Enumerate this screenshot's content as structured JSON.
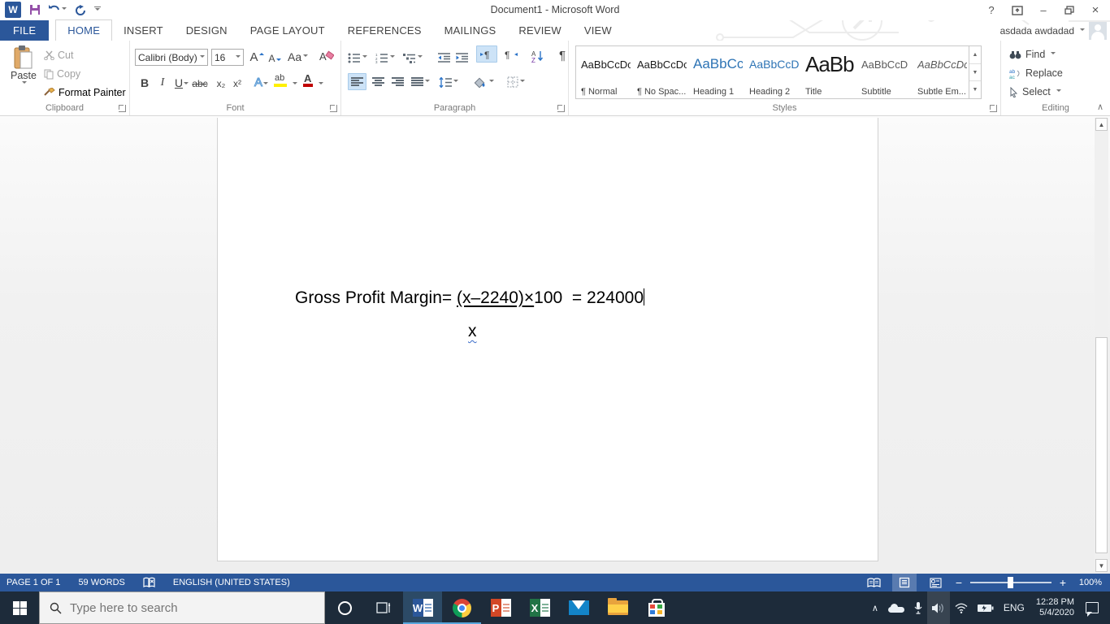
{
  "colors": {
    "accent": "#2b579a",
    "heading": "#2e74b5",
    "statusbar": "#2b579a",
    "taskbar": "#1d2b3a",
    "taskbar_active": "#2c4a66",
    "run_underline": "#58a6dc",
    "wavy": "#3a6bc9",
    "hl_yellow": "#fff000",
    "font_red": "#c00000"
  },
  "titlebar": {
    "title": "Document1 - Microsoft Word",
    "help_glyph": "?",
    "account_name": "asdada awdadad"
  },
  "tabs": {
    "file": "FILE",
    "items": [
      "HOME",
      "INSERT",
      "DESIGN",
      "PAGE LAYOUT",
      "REFERENCES",
      "MAILINGS",
      "REVIEW",
      "VIEW"
    ]
  },
  "ribbon": {
    "clipboard": {
      "label": "Clipboard",
      "paste": "Paste",
      "cut": "Cut",
      "copy": "Copy",
      "format_painter": "Format Painter"
    },
    "font": {
      "label": "Font",
      "family": "Calibri (Body)",
      "size": "16",
      "bold": "B",
      "italic": "I",
      "underline": "U",
      "strike": "abc",
      "subscript": "x₂",
      "superscript": "x²",
      "case": "Aa",
      "effects": "A",
      "highlight": "ab",
      "color": "A"
    },
    "paragraph": {
      "label": "Paragraph",
      "pilcrow": "¶",
      "sort_a": "A",
      "sort_z": "Z"
    },
    "styles": {
      "label": "Styles",
      "items": [
        {
          "sample": "AaBbCcDc",
          "name": "¶ Normal"
        },
        {
          "sample": "AaBbCcDc",
          "name": "¶ No Spac..."
        },
        {
          "sample": "AaBbCc",
          "name": "Heading 1"
        },
        {
          "sample": "AaBbCcD",
          "name": "Heading 2"
        },
        {
          "sample": "AaBb",
          "name": "Title"
        },
        {
          "sample": "AaBbCcD",
          "name": "Subtitle"
        },
        {
          "sample": "AaBbCcDc",
          "name": "Subtle Em..."
        }
      ]
    },
    "editing": {
      "label": "Editing",
      "find": "Find",
      "replace": "Replace",
      "select": "Select"
    }
  },
  "document": {
    "line1_prefix": "Gross Profit Margin= ",
    "line1_fraction_numerator_underlined": "(x–2240)×",
    "line1_suffix": "100  = 224000",
    "line2_denominator": "x"
  },
  "statusbar": {
    "page": "PAGE 1 OF 1",
    "words": "59 WORDS",
    "language": "ENGLISH (UNITED STATES)",
    "zoom_level": "100%"
  },
  "taskbar": {
    "search_placeholder": "Type here to search",
    "language": "ENG",
    "time": "12:28 PM",
    "date": "5/4/2020"
  }
}
